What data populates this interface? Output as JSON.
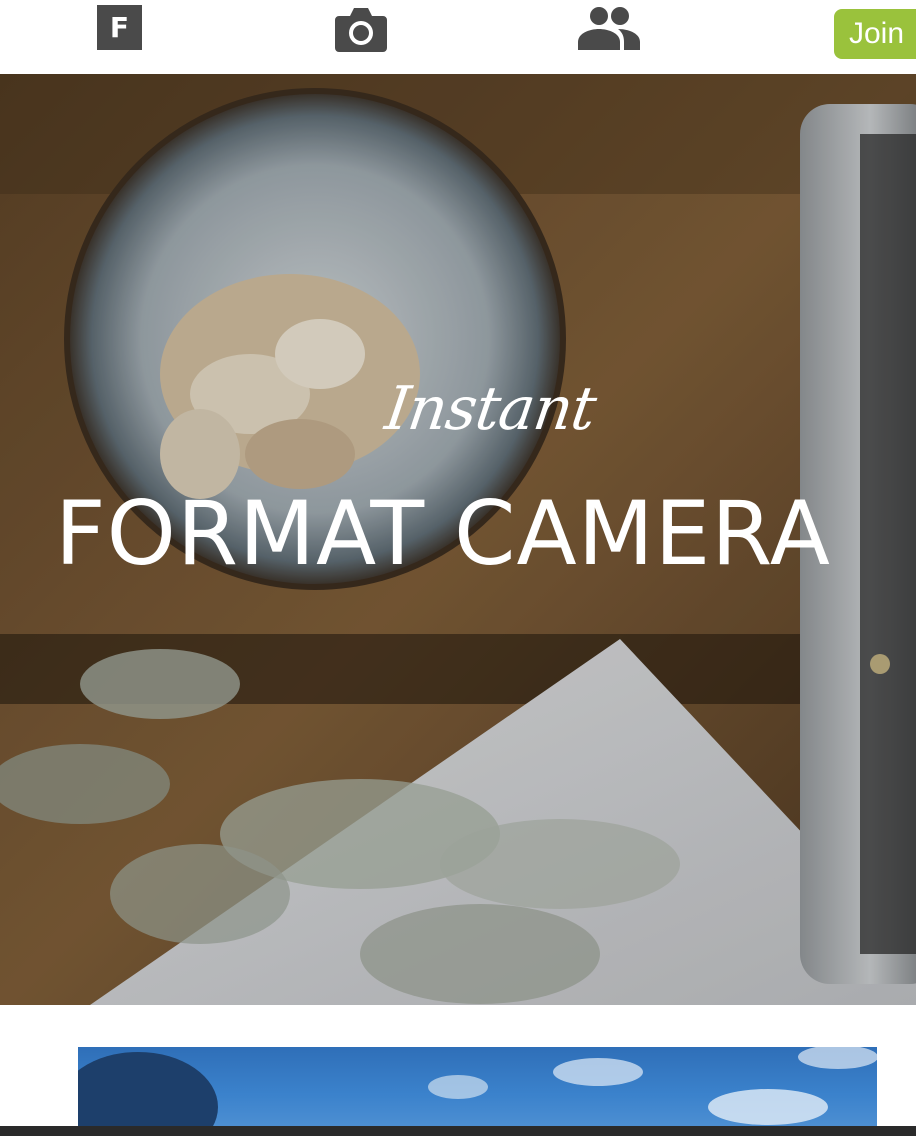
{
  "nav": {
    "logo_letter": "F",
    "camera_icon": "camera-icon",
    "people_icon": "people-icon",
    "join_label": "Join"
  },
  "hero": {
    "kicker": "Instant",
    "title": "FORMAT CAMERA"
  },
  "colors": {
    "join_button": "#9ac23c",
    "logo_box": "#4a4a4a",
    "bottom_strip": "#2a2a2a"
  }
}
